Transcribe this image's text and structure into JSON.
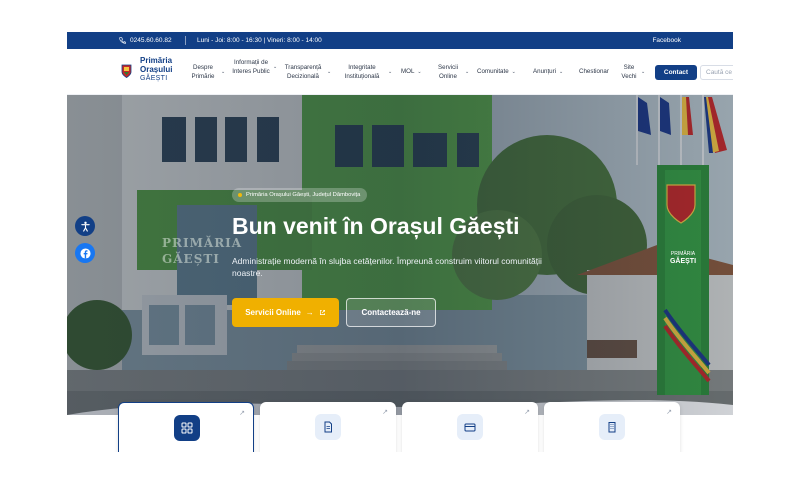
{
  "topbar": {
    "phone": "0245.60.60.82",
    "hours": "Luni - Joi: 8:00 - 16:30 | Vineri: 8:00 - 14:00",
    "facebook": "Facebook"
  },
  "brand": {
    "line1": "Primăria",
    "line2": "Orașului",
    "line3": "GĂEȘTI"
  },
  "nav": [
    {
      "label": "Despre Primărie"
    },
    {
      "label": "Informații de Interes Public"
    },
    {
      "label": "Transparență Decizională"
    },
    {
      "label": "Integritate Instituțională"
    },
    {
      "label": "MOL"
    },
    {
      "label": "Servicii Online"
    },
    {
      "label": "Comunitate"
    },
    {
      "label": "Anunțuri"
    },
    {
      "label": "Chestionar"
    },
    {
      "label": "Site Vechi"
    }
  ],
  "contact_button": "Contact",
  "search_placeholder": "Caută ce",
  "hero": {
    "pill": "Primăria Orașului Găești, Județul Dâmbovița",
    "title": "Bun venit în Orașul Găești",
    "subtitle": "Administrație modernă în slujba cetățenilor. Împreună construim viitorul comunității noastre.",
    "primary_button": "Servicii Online",
    "secondary_button": "Contactează-ne",
    "building_sign": "PRIMĂRIA GĂEȘTI",
    "monument_line1": "PRIMĂRIA",
    "monument_line2": "GĂEȘTI"
  },
  "cards": [
    {
      "icon": "grid-icon"
    },
    {
      "icon": "document-icon"
    },
    {
      "icon": "credit-card-icon"
    },
    {
      "icon": "building-icon"
    }
  ],
  "colors": {
    "brand_blue": "#123f86",
    "accent_yellow": "#f0b000",
    "facebook_blue": "#1877f2"
  }
}
